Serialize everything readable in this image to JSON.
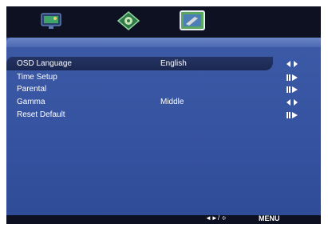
{
  "tabs": [
    {
      "icon": "picture-icon"
    },
    {
      "icon": "audio-settings-icon"
    },
    {
      "icon": "setup-icon",
      "selected": true
    }
  ],
  "menu_items": [
    {
      "label": "OSD Language",
      "value": "English",
      "nav": "left-right-arrows-icon",
      "selected": true
    },
    {
      "label": "Time Setup",
      "value": "",
      "nav": "enter-arrow-icon"
    },
    {
      "label": "Parental",
      "value": "",
      "nav": "enter-arrow-icon"
    },
    {
      "label": "Gamma",
      "value": "Middle",
      "nav": "left-right-arrows-icon"
    },
    {
      "label": "Reset Default",
      "value": "",
      "nav": "enter-arrow-icon"
    }
  ],
  "footer": {
    "nav_hint": "◄►/ ≑",
    "menu_label": "MENU"
  },
  "colors": {
    "panel": "#3552a0",
    "highlight": "#1f2d58",
    "background": "#0f1324"
  }
}
